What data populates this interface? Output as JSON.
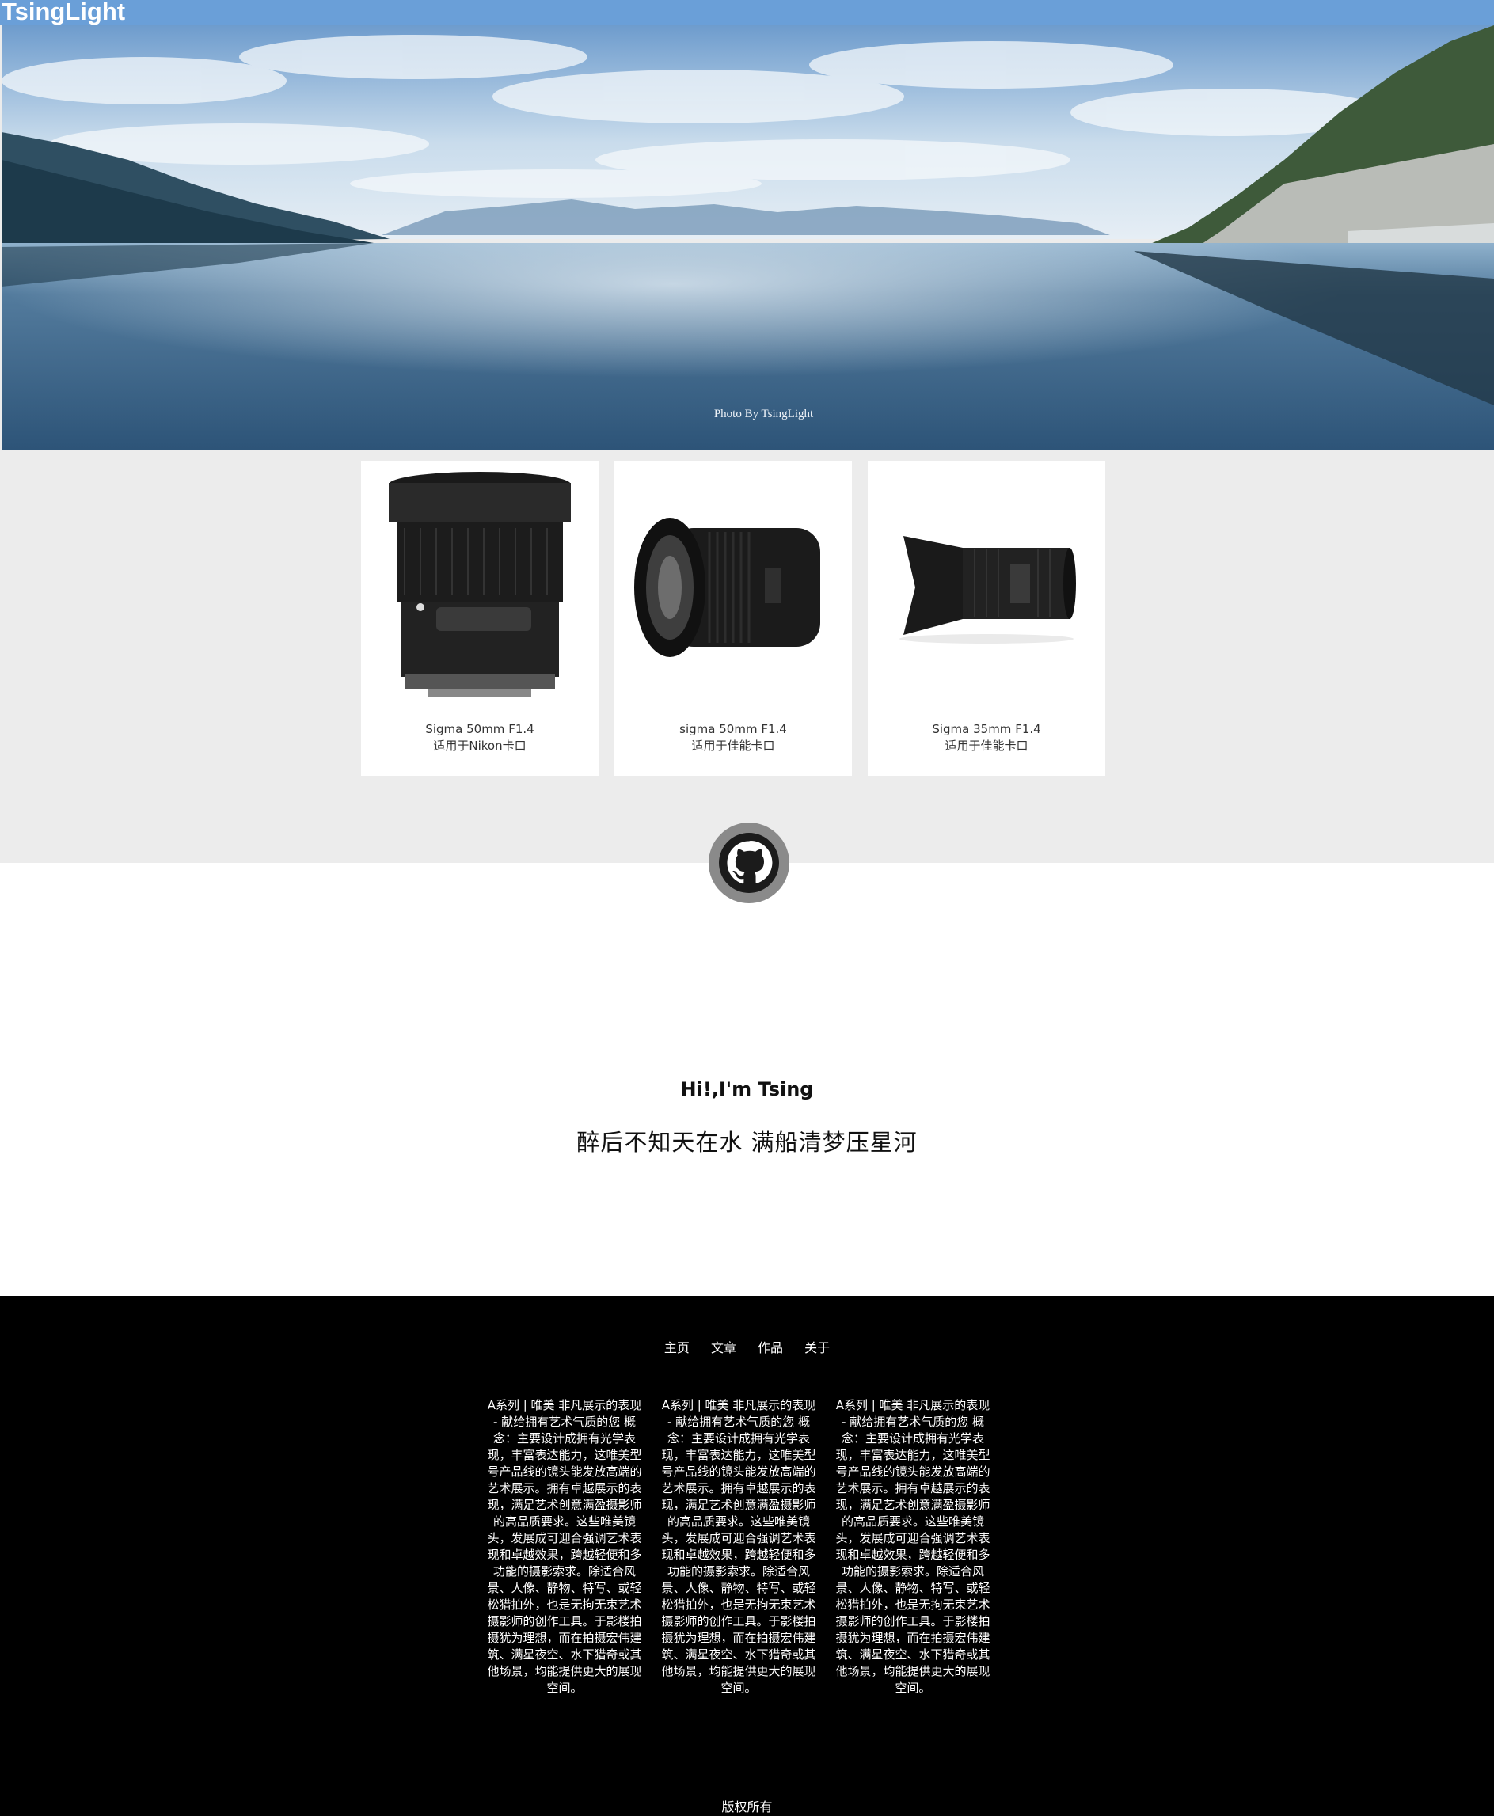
{
  "header": {
    "brand": "TsingLight"
  },
  "hero": {
    "credit": "Photo By TsingLight"
  },
  "products": [
    {
      "name": "Sigma 50mm F1.4",
      "mount": "适用于Nikon卡口"
    },
    {
      "name": "sigma 50mm F1.4",
      "mount": "适用于佳能卡口"
    },
    {
      "name": "Sigma 35mm F1.4",
      "mount": "适用于佳能卡口"
    }
  ],
  "profile": {
    "greeting": "Hi!,I'm Tsing",
    "poem": "醉后不知天在水 满船清梦压星河"
  },
  "footer": {
    "nav": [
      "主页",
      "文章",
      "作品",
      "关于"
    ],
    "columns": [
      "A系列 | 唯美 非凡展示的表现 - 献给拥有艺术气质的您 概念：主要设计成拥有光学表现，丰富表达能力，这唯美型号产品线的镜头能发放高端的艺术展示。拥有卓越展示的表现，满足艺术创意满盈摄影师的高品质要求。这些唯美镜头，发展成可迎合强调艺术表现和卓越效果，跨越轻便和多功能的摄影索求。除适合风景、人像、静物、特写、或轻松猎拍外，也是无拘无束艺术摄影师的创作工具。于影楼拍摄犹为理想，而在拍摄宏伟建筑、满星夜空、水下猎奇或其他场景，均能提供更大的展现空间。",
      "A系列 | 唯美 非凡展示的表现 - 献给拥有艺术气质的您 概念：主要设计成拥有光学表现，丰富表达能力，这唯美型号产品线的镜头能发放高端的艺术展示。拥有卓越展示的表现，满足艺术创意满盈摄影师的高品质要求。这些唯美镜头，发展成可迎合强调艺术表现和卓越效果，跨越轻便和多功能的摄影索求。除适合风景、人像、静物、特写、或轻松猎拍外，也是无拘无束艺术摄影师的创作工具。于影楼拍摄犹为理想，而在拍摄宏伟建筑、满星夜空、水下猎奇或其他场景，均能提供更大的展现空间。",
      "A系列 | 唯美 非凡展示的表现 - 献给拥有艺术气质的您 概念：主要设计成拥有光学表现，丰富表达能力，这唯美型号产品线的镜头能发放高端的艺术展示。拥有卓越展示的表现，满足艺术创意满盈摄影师的高品质要求。这些唯美镜头，发展成可迎合强调艺术表现和卓越效果，跨越轻便和多功能的摄影索求。除适合风景、人像、静物、特写、或轻松猎拍外，也是无拘无束艺术摄影师的创作工具。于影楼拍摄犹为理想，而在拍摄宏伟建筑、满星夜空、水下猎奇或其他场景，均能提供更大的展现空间。"
    ],
    "copyright": "版权所有"
  },
  "colors": {
    "header_bg": "#6a9fd8",
    "page_bg": "#ececec",
    "footer_bg": "#000000",
    "avatar_ring": "#8a8a8a"
  },
  "icons": {
    "avatar": "github-icon"
  }
}
